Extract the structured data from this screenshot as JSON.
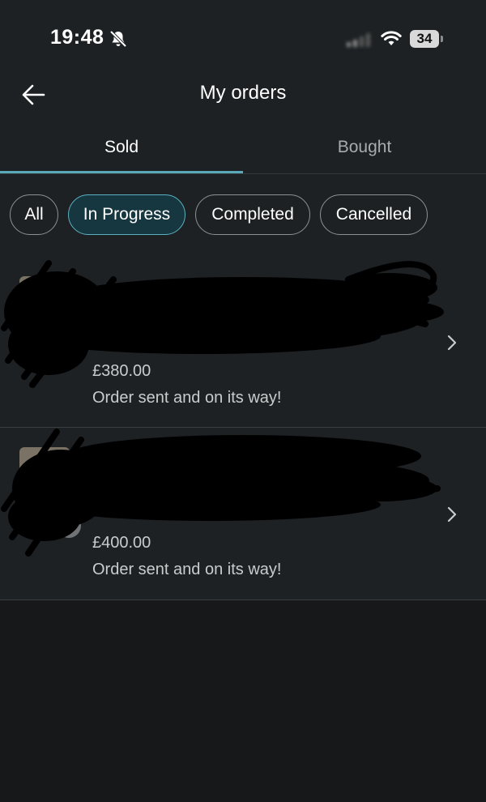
{
  "status_bar": {
    "time": "19:48",
    "battery": "34",
    "icons": [
      "bell-muted-icon",
      "signal-icon",
      "wifi-icon",
      "battery-icon"
    ]
  },
  "header": {
    "title": "My orders",
    "back_icon": "arrow-left-icon"
  },
  "tabs": [
    {
      "label": "Sold",
      "active": true
    },
    {
      "label": "Bought",
      "active": false
    }
  ],
  "filters": [
    {
      "label": "All",
      "active": false
    },
    {
      "label": "In Progress",
      "active": true
    },
    {
      "label": "Completed",
      "active": false
    },
    {
      "label": "Cancelled",
      "active": false
    }
  ],
  "orders": [
    {
      "price": "£380.00",
      "status": "Order sent and on its way!"
    },
    {
      "price": "£400.00",
      "status": "Order sent and on its way!"
    }
  ],
  "colors": {
    "accent": "#5aa9b9",
    "active_chip_bg": "#173740",
    "surface": "#1d2123",
    "background": "#161819"
  }
}
